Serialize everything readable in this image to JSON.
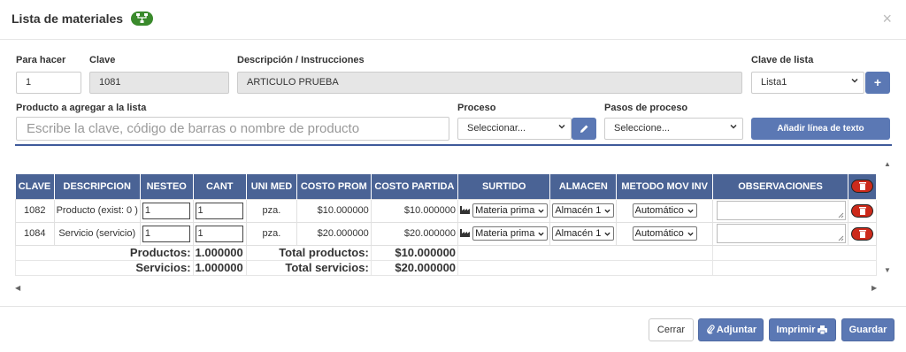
{
  "modal": {
    "title": "Lista de materiales",
    "badge_icon": "network-icon",
    "close_icon": "×"
  },
  "form": {
    "para_hacer_label": "Para hacer",
    "para_hacer_value": "1",
    "clave_label": "Clave",
    "clave_value": "1081",
    "descripcion_label": "Descripción / Instrucciones",
    "descripcion_value": "ARTICULO PRUEBA",
    "clave_lista_label": "Clave de lista",
    "clave_lista_value": "Lista1",
    "add_lista_icon": "+",
    "producto_label": "Producto a agregar a la lista",
    "producto_placeholder": "Escribe la clave, código de barras o nombre de producto",
    "proceso_label": "Proceso",
    "proceso_value": "Seleccionar...",
    "pasos_label": "Pasos de proceso",
    "pasos_value": "Seleccione...",
    "add_text_line": "Añadir línea de texto"
  },
  "table": {
    "headers": [
      "CLAVE",
      "DESCRIPCION",
      "NESTEO",
      "CANT",
      "UNI MED",
      "COSTO PROM",
      "COSTO PARTIDA",
      "SURTIDO",
      "ALMACEN",
      "METODO MOV INV",
      "OBSERVACIONES"
    ],
    "rows": [
      {
        "clave": "1082",
        "descripcion": "Producto (exist: 0 )",
        "nesteo": "1",
        "cant": "1",
        "uni_med": "pza.",
        "costo_prom": "$10.000000",
        "costo_partida": "$10.000000",
        "surtido": "Materia prima",
        "almacen": "Almacén 1",
        "metodo": "Automático",
        "observaciones": ""
      },
      {
        "clave": "1084",
        "descripcion": "Servicio (servicio)",
        "nesteo": "1",
        "cant": "1",
        "uni_med": "pza.",
        "costo_prom": "$20.000000",
        "costo_partida": "$20.000000",
        "surtido": "Materia prima",
        "almacen": "Almacén 1",
        "metodo": "Automático",
        "observaciones": ""
      }
    ],
    "totals": {
      "productos_label": "Productos:",
      "productos_value": "1.000000",
      "total_productos_label": "Total productos:",
      "total_productos_value": "$10.000000",
      "servicios_label": "Servicios:",
      "servicios_value": "1.000000",
      "total_servicios_label": "Total servicios:",
      "total_servicios_value": "$20.000000"
    }
  },
  "footer": {
    "cerrar": "Cerrar",
    "adjuntar": "Adjuntar",
    "imprimir": "Imprimir",
    "guardar": "Guardar"
  },
  "colors": {
    "primary": "#5b78b4",
    "header_bg": "#4a6395",
    "delete": "#cc2a1b",
    "badge": "#3a8a2c"
  }
}
